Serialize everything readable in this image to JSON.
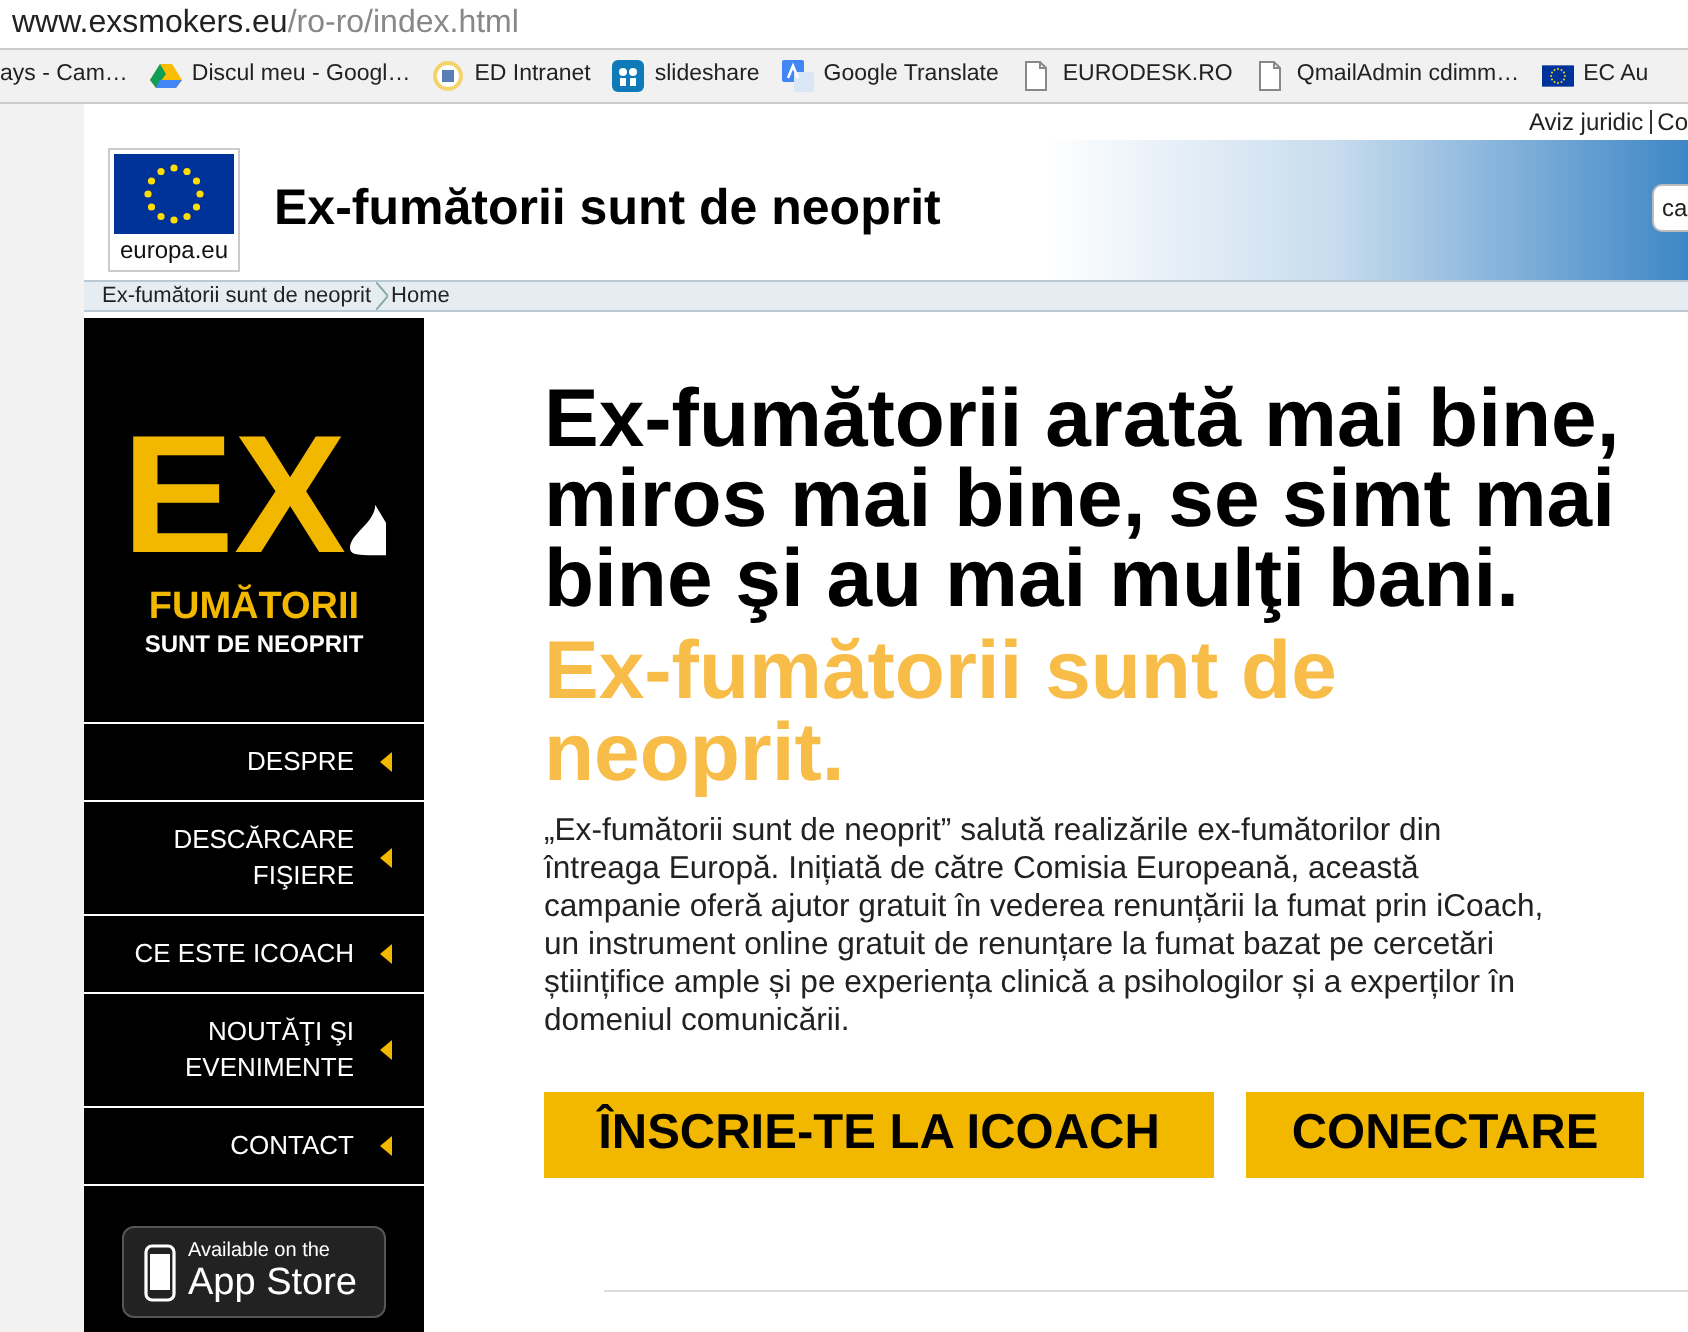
{
  "browser": {
    "url_host": "www.exsmokers.eu",
    "url_path": "/ro-ro/index.html",
    "bookmarks": [
      {
        "label": "ays - Cam…"
      },
      {
        "label": "Discul meu - Googl…",
        "kind": "drive"
      },
      {
        "label": "ED Intranet",
        "kind": "intranet"
      },
      {
        "label": "slideshare",
        "kind": "slideshare"
      },
      {
        "label": "Google Translate",
        "kind": "translate"
      },
      {
        "label": "EURODESK.RO",
        "kind": "page"
      },
      {
        "label": "QmailAdmin cdimm…",
        "kind": "page"
      },
      {
        "label": "EC Au",
        "kind": "eu"
      }
    ]
  },
  "top_links": [
    "Aviz juridic",
    "Co"
  ],
  "header": {
    "logo_caption": "europa.eu",
    "site_title": "Ex-fumătorii sunt de neoprit",
    "search_value": "ca"
  },
  "breadcrumb": [
    "Ex-fumătorii sunt de neoprit",
    "Home"
  ],
  "sidebar": {
    "logo": {
      "mark": "EX",
      "line_1": "FUMĂTORII",
      "line_2": "SUNT DE NEOPRIT"
    },
    "items": [
      "DESPRE",
      "DESCĂRCARE FIŞIERE",
      "CE ESTE ICOACH",
      "NOUTĂŢI ŞI EVENIMENTE",
      "CONTACT"
    ],
    "app_store": {
      "small": "Available on the",
      "big": "App Store"
    }
  },
  "main": {
    "headline": "Ex-fumătorii arată mai bine, miros mai bine, se simt mai bine şi au mai mulţi bani.",
    "subheadline": "Ex-fumătorii sunt de neoprit.",
    "body": "„Ex-fumătorii sunt de neoprit” salută realizările ex-fumătorilor din întreaga Europă. Inițiată de către Comisia Europeană, această campanie oferă ajutor gratuit în vederea renunțării la fumat prin iCoach, un instrument online gratuit de renunțare la fumat bazat pe cercetări științifice ample și pe experiența clinică a psihologilor și a experților în domeniul comunicării.",
    "buttons": [
      "ÎNSCRIE-TE LA ICOACH",
      "CONECTARE"
    ]
  }
}
